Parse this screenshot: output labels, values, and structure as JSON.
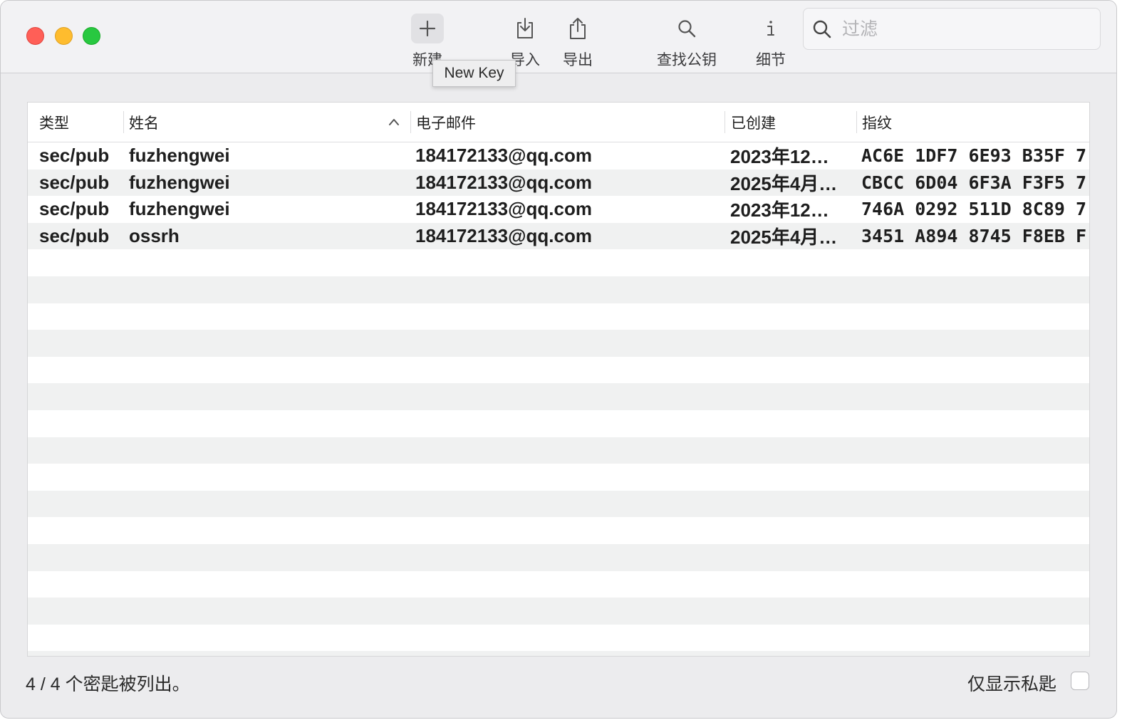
{
  "toolbar": {
    "new_label": "新建",
    "import_label": "导入",
    "export_label": "导出",
    "find_key_label": "查找公钥",
    "details_label": "细节"
  },
  "tooltip": "New Key",
  "search": {
    "placeholder": "过滤",
    "value": ""
  },
  "table": {
    "columns": [
      "类型",
      "姓名",
      "电子邮件",
      "已创建",
      "指纹"
    ],
    "sort_column": "姓名",
    "sort_direction": "ascending",
    "rows": [
      {
        "type": "sec/pub",
        "name": "fuzhengwei",
        "email": "184172133@qq.com",
        "created": "2023年12…",
        "fingerprint": "AC6E 1DF7 6E93 B35F 7"
      },
      {
        "type": "sec/pub",
        "name": "fuzhengwei",
        "email": "184172133@qq.com",
        "created": "2025年4月…",
        "fingerprint": "CBCC 6D04 6F3A F3F5 7"
      },
      {
        "type": "sec/pub",
        "name": "fuzhengwei",
        "email": "184172133@qq.com",
        "created": "2023年12…",
        "fingerprint": "746A 0292 511D 8C89 7"
      },
      {
        "type": "sec/pub",
        "name": "ossrh",
        "email": "184172133@qq.com",
        "created": "2025年4月…",
        "fingerprint": "3451 A894 8745 F8EB F"
      }
    ]
  },
  "footer": {
    "status": "4 / 4 个密匙被列出。",
    "private_only_label": "仅显示私匙",
    "private_only_checked": false
  },
  "colors": {
    "close": "#ff5f57",
    "minimize": "#febc2e",
    "maximize": "#28c840",
    "row_stripe": "#f0f1f1"
  }
}
